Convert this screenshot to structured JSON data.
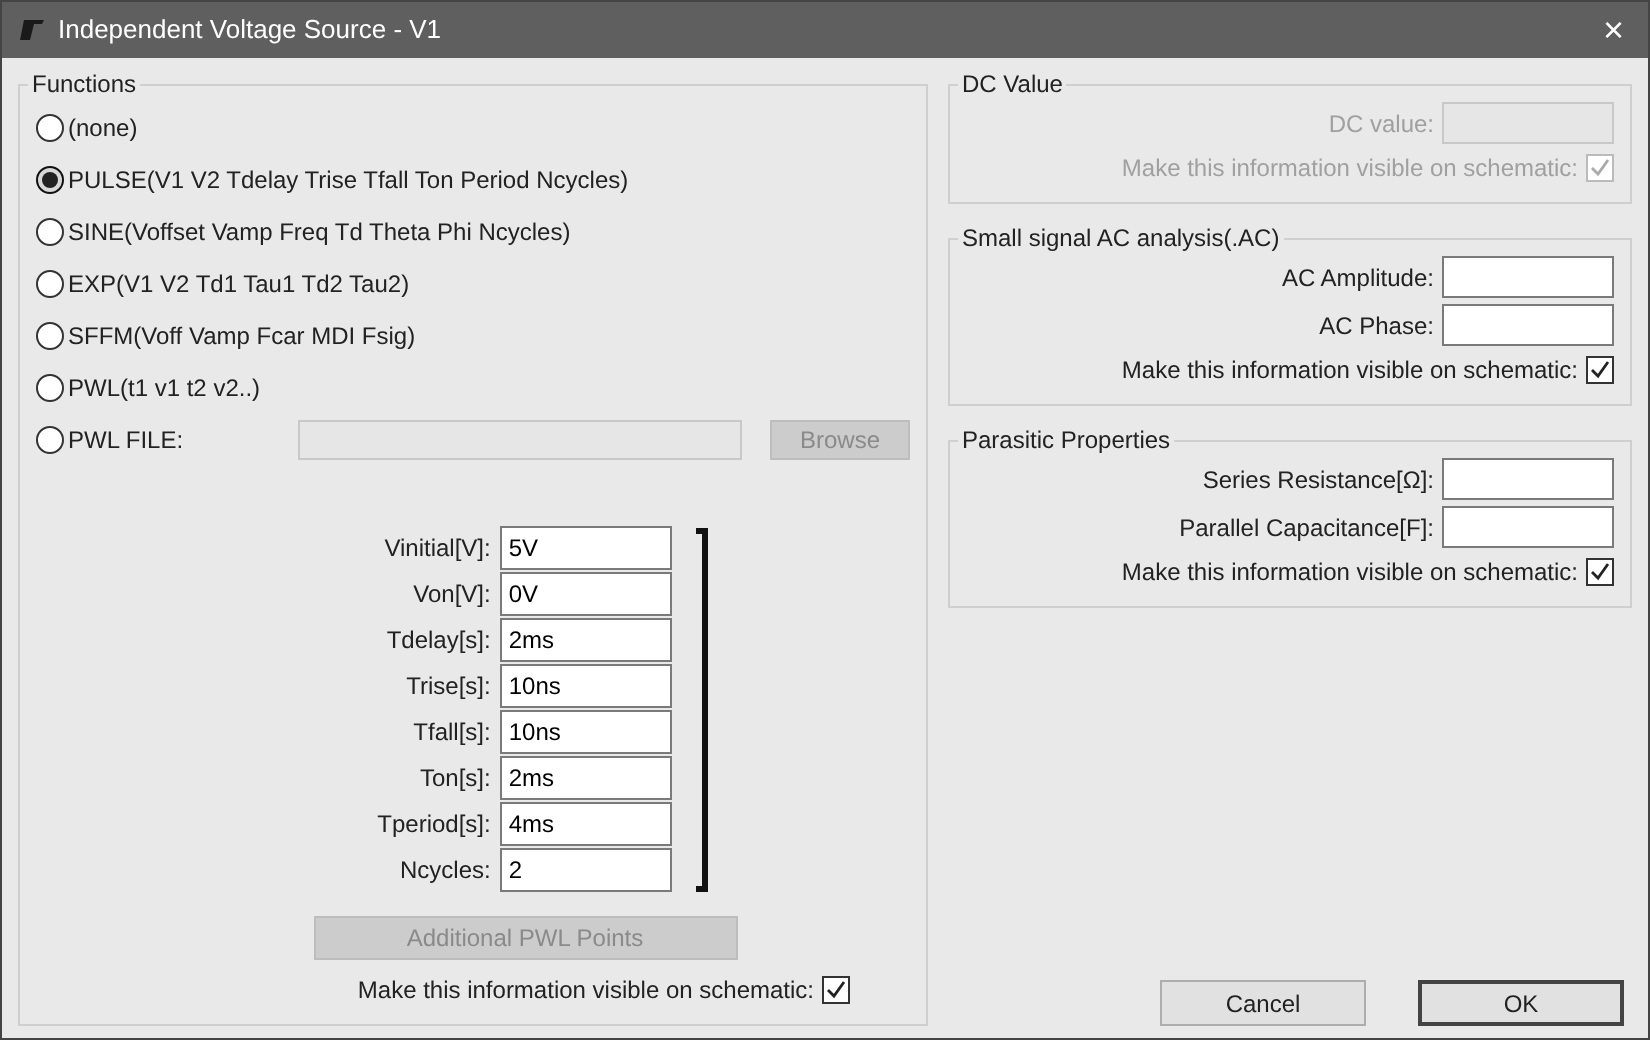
{
  "window": {
    "title": "Independent Voltage Source - V1",
    "close": "×"
  },
  "functions": {
    "title": "Functions",
    "options": [
      {
        "label": "(none)",
        "selected": false
      },
      {
        "label": "PULSE(V1 V2 Tdelay Trise Tfall Ton Period Ncycles)",
        "selected": true
      },
      {
        "label": "SINE(Voffset Vamp Freq Td Theta Phi Ncycles)",
        "selected": false
      },
      {
        "label": "EXP(V1 V2 Td1 Tau1 Td2 Tau2)",
        "selected": false
      },
      {
        "label": "SFFM(Voff Vamp Fcar MDI Fsig)",
        "selected": false
      },
      {
        "label": "PWL(t1 v1 t2 v2..)",
        "selected": false
      },
      {
        "label": "PWL FILE:",
        "selected": false,
        "kind": "file"
      }
    ],
    "pwl_file_field": {
      "disabled": true
    },
    "browse_button": {
      "label": "Browse",
      "disabled": true
    },
    "parameters": [
      {
        "label": "Vinitial[V]:",
        "value": "5V"
      },
      {
        "label": "Von[V]:",
        "value": "0V"
      },
      {
        "label": "Tdelay[s]:",
        "value": "2ms"
      },
      {
        "label": "Trise[s]:",
        "value": "10ns"
      },
      {
        "label": "Tfall[s]:",
        "value": "10ns"
      },
      {
        "label": "Ton[s]:",
        "value": "2ms"
      },
      {
        "label": "Tperiod[s]:",
        "value": "4ms"
      },
      {
        "label": "Ncycles:",
        "value": "2"
      }
    ],
    "additional_button": {
      "label": "Additional PWL Points",
      "disabled": true
    },
    "visible": {
      "label": "Make this information visible on schematic:",
      "checked": true
    }
  },
  "dc_value": {
    "title": "DC Value",
    "fields": [
      {
        "label": "DC value:",
        "disabled": true
      }
    ],
    "visible": {
      "label": "Make this information visible on schematic:",
      "checked": true,
      "disabled": true
    }
  },
  "ac_analysis": {
    "title": "Small signal AC analysis(.AC)",
    "fields": [
      {
        "label": "AC Amplitude:",
        "disabled": false
      },
      {
        "label": "AC Phase:",
        "disabled": false
      }
    ],
    "visible": {
      "label": "Make this information visible on schematic:",
      "checked": true,
      "disabled": false
    }
  },
  "parasitic": {
    "title": "Parasitic Properties",
    "fields": [
      {
        "label": "Series Resistance[Ω]:",
        "disabled": false
      },
      {
        "label": "Parallel Capacitance[F]:",
        "disabled": false
      }
    ],
    "visible": {
      "label": "Make this information visible on schematic:",
      "checked": true,
      "disabled": false
    }
  },
  "buttons": [
    {
      "label": "Cancel",
      "default": false
    },
    {
      "label": "OK",
      "default": true
    }
  ]
}
